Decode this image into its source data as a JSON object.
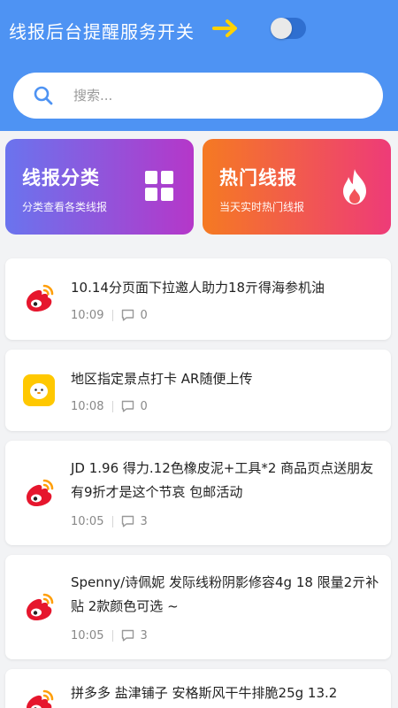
{
  "header": {
    "title": "线报后台提醒服务开关",
    "arrow_color": "#ffd200",
    "toggle_on": false
  },
  "search": {
    "placeholder": "搜索..."
  },
  "cards": [
    {
      "title": "线报分类",
      "subtitle": "分类查看各类线报",
      "icon": "grid-icon"
    },
    {
      "title": "热门线报",
      "subtitle": "当天实时热门线报",
      "icon": "fire-icon"
    }
  ],
  "items": [
    {
      "title": "10.14分页面下拉邀人助力18亓得海参机油",
      "time": "10:09",
      "comments": "0",
      "source_icon": "weibo-icon"
    },
    {
      "title": "地区指定景点打卡 AR随便上传",
      "time": "10:08",
      "comments": "0",
      "source_icon": "qq-icon"
    },
    {
      "title": "JD 1.96 得力.12色橡皮泥+工具*2 商品页点送朋友有9折才是这个节哀 包邮活动",
      "time": "10:05",
      "comments": "3",
      "source_icon": "weibo-icon"
    },
    {
      "title": "Spenny/诗佩妮 发际线粉阴影修容4g 18 限量2亓补贴 2款颜色可选 ~",
      "time": "10:05",
      "comments": "3",
      "source_icon": "weibo-icon"
    },
    {
      "title": "拼多多 盐津铺子 安格斯风干牛排脆25g 13.2",
      "time": "",
      "comments": "",
      "source_icon": "weibo-icon"
    }
  ]
}
